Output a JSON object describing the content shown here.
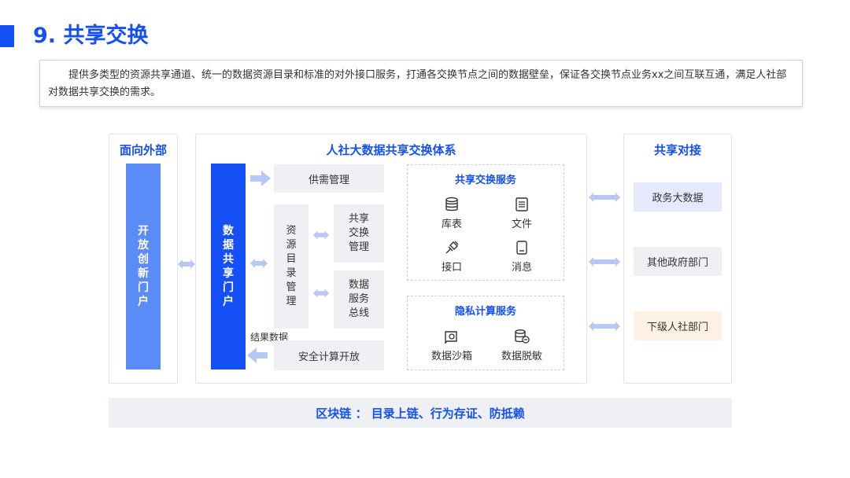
{
  "title": "9. 共享交换",
  "description": "提供多类型的资源共享通道、统一的数据资源目录和标准的对外接口服务，打通各交换节点之间的数据壁垒，保证各交换节点业务xx之间互联互通，满足人社部对数据共享交换的需求。",
  "left_panel": {
    "title": "面向外部",
    "bar": "开放创新门户"
  },
  "center_panel": {
    "title": "人社大数据共享交换体系",
    "bar": "数据共享门户",
    "supply": "供需管理",
    "catalog": "资源目录管理",
    "exchange": "共享交换管理",
    "bus": "数据服务总线",
    "result_label": "结果数据",
    "secure": "安全计算开放",
    "service": {
      "title": "共享交换服务",
      "items": [
        {
          "label": "库表",
          "icon": "database-icon"
        },
        {
          "label": "文件",
          "icon": "file-icon"
        },
        {
          "label": "接口",
          "icon": "plug-icon"
        },
        {
          "label": "消息",
          "icon": "message-icon"
        }
      ]
    },
    "privacy": {
      "title": "隐私计算服务",
      "items": [
        {
          "label": "数据沙箱",
          "icon": "sandbox-icon"
        },
        {
          "label": "数据脱敏",
          "icon": "desensitize-icon"
        }
      ]
    }
  },
  "right_panel": {
    "title": "共享对接",
    "items": [
      {
        "label": "政务大数据",
        "color": "#e6e9fb"
      },
      {
        "label": "其他政府部门",
        "color": "#eef0f4"
      },
      {
        "label": "下级人社部门",
        "color": "#fdf1e3"
      }
    ]
  },
  "bottom": "区块链 ： 目录上链、行为存证、防抵赖",
  "colors": {
    "accent": "#1450f5",
    "left_bar": "#5b8bf7",
    "arrow": "#b7c8f5"
  }
}
